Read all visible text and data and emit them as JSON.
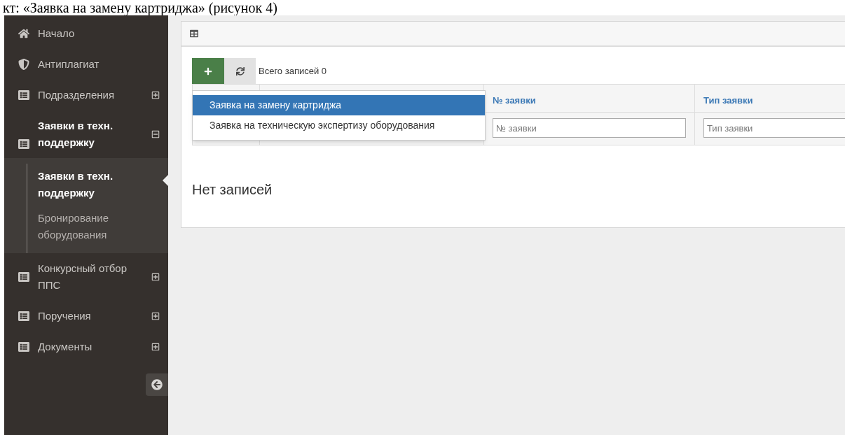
{
  "caption": "кт: «Заявка на замену картриджа» (рисунок 4)",
  "sidebar": {
    "items": [
      {
        "label": "Начало",
        "kind": "home"
      },
      {
        "label": "Антиплагиат",
        "kind": "shield"
      },
      {
        "label": "Подразделения",
        "kind": "list",
        "expanded": false
      },
      {
        "label": "Заявки в техн. поддержку",
        "kind": "list",
        "expanded": true,
        "children": [
          {
            "label": "Заявки в техн. поддержку",
            "selected": true
          },
          {
            "label": "Бронирование оборудования",
            "selected": false
          }
        ]
      },
      {
        "label": "Конкурсный отбор ППС",
        "kind": "list",
        "expanded": false
      },
      {
        "label": "Поручения",
        "kind": "list",
        "expanded": false
      },
      {
        "label": "Документы",
        "kind": "list",
        "expanded": false
      }
    ]
  },
  "toolbar": {
    "total": "Всего записей 0"
  },
  "dropdown": [
    {
      "label": "Заявка на замену картриджа",
      "selected": true
    },
    {
      "label": "Заявка на техническую экспертизу оборудования",
      "selected": false
    }
  ],
  "table": {
    "columns": [
      {
        "label": "№ заявки",
        "placeholder": "№ заявки"
      },
      {
        "label": "Тип заявки",
        "placeholder": "Тип заявки"
      }
    ]
  },
  "empty_message": "Нет записей"
}
